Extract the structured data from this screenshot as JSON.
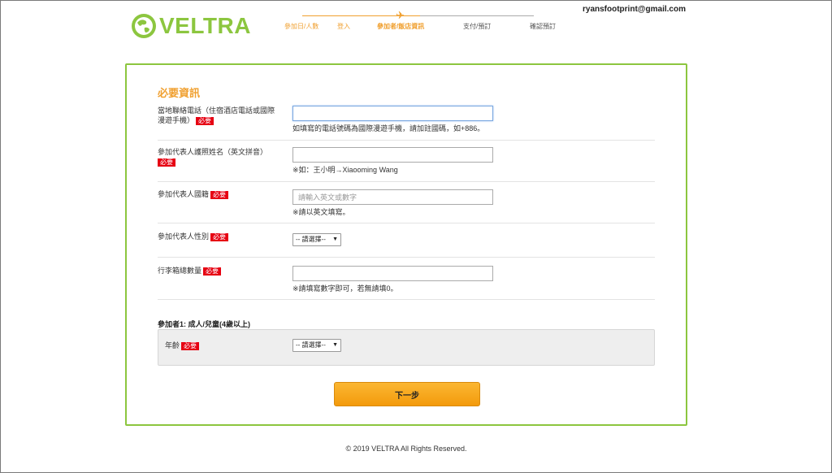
{
  "brand": {
    "name": "VELTRA",
    "color": "#8cc63f",
    "accent": "#f0a030"
  },
  "user": {
    "email": "ryansfootprint@gmail.com"
  },
  "progress": {
    "steps": [
      {
        "label": "參加日/人數",
        "state": "done"
      },
      {
        "label": "登入",
        "state": "done"
      },
      {
        "label": "參加者/飯店資訊",
        "state": "current"
      },
      {
        "label": "支付/預訂",
        "state": "todo"
      },
      {
        "label": "確認預訂",
        "state": "todo"
      }
    ],
    "icon": "plane-icon"
  },
  "form": {
    "title": "必要資訊",
    "required_badge": "必要",
    "phone": {
      "label": "當地聯絡電話（住宿酒店電話或國際漫遊手機）",
      "value": "",
      "hint": "如填寫的電話號碼為國際漫遊手機，請加註國碼，如+886。"
    },
    "passport_name": {
      "label": "參加代表人護照姓名（英文拼音）",
      "value": "",
      "hint": "※如：王小明→Xiaooming Wang"
    },
    "nationality": {
      "label": "參加代表人國籍",
      "placeholder": "請輸入英文或數字",
      "hint": "※請以英文填寫。"
    },
    "gender": {
      "label": "參加代表人性別",
      "selected": "-- 請選擇--"
    },
    "luggage": {
      "label": "行李箱總數量",
      "value": "",
      "hint": "※請填寫數字即可，若無請填0。"
    },
    "participant": {
      "title": "參加者1: 成人/兒童(4歲以上)",
      "age_label": "年齡",
      "age_selected": "-- 請選擇--"
    },
    "next_button": "下一步"
  },
  "footer": {
    "copyright": "© 2019 VELTRA All Rights Reserved."
  }
}
